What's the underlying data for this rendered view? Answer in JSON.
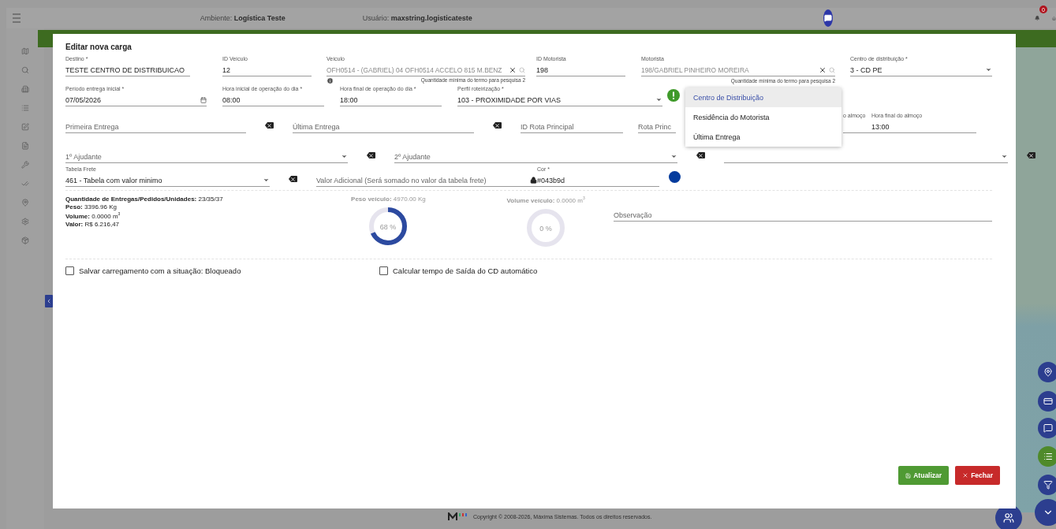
{
  "header": {
    "ambiente_label": "Ambiente:",
    "ambiente_value": "Logística Teste",
    "usuario_label": "Usuário:",
    "usuario_value": "maxstring.logisticateste",
    "notification_count": "0"
  },
  "modal": {
    "title": "Editar nova carga",
    "sections": [
      {
        "fields": [
          {
            "kind": "text",
            "label": "Destino *",
            "value": "TESTE CENTRO DE DISTRIBUICAO"
          },
          {
            "kind": "text",
            "label": "ID Veículo",
            "value": "12"
          },
          {
            "kind": "search",
            "label": "Veículo",
            "value": "OFH0514 - (GABRIEL) 04 OFH0514 ACCELO 815 M.BENZ",
            "disabled": true,
            "helper": "Quantidade mínima do termo para pesquisa 2",
            "info": true
          },
          {
            "kind": "text",
            "label": "ID Motorista",
            "value": "198"
          },
          {
            "kind": "search",
            "label": "Motorista",
            "value": "198/GABRIEL PINHEIRO MOREIRA",
            "disabled": true,
            "helper": "Quantidade mínima do termo para pesquisa 2"
          },
          {
            "kind": "select",
            "label": "Centro de distribuição *",
            "value": "3 - CD PE"
          }
        ]
      },
      {
        "fields": [
          {
            "kind": "date",
            "label": "Período entrega inicial *",
            "value": "07/05/2026"
          },
          {
            "kind": "text",
            "label": "Hora inicial de operação do dia *",
            "value": "08:00"
          },
          {
            "kind": "text",
            "label": "Hora final de operação do dia *",
            "value": "18:00"
          },
          {
            "kind": "select",
            "label": "Perfil roteirização *",
            "value": "103 - PROXIMIDADE POR VIAS",
            "warning": true
          }
        ]
      },
      {
        "fields": [
          {
            "kind": "text",
            "placeholder": "Primeira Entrega",
            "clearable": true
          },
          {
            "kind": "text",
            "placeholder": "Última Entrega",
            "clearable": true
          },
          {
            "kind": "text",
            "placeholder": "ID Rota Principal"
          },
          {
            "kind": "text",
            "placeholder": "Rota Princ"
          },
          {
            "kind": "text",
            "label": "o almoço"
          },
          {
            "kind": "text",
            "label": "Hora final do almoço",
            "value": "13:00"
          }
        ]
      },
      {
        "fields": [
          {
            "kind": "select",
            "placeholder": "1º Ajudante",
            "clearable": true
          },
          {
            "kind": "select",
            "placeholder": "2º Ajudante",
            "clearable": true
          },
          {
            "kind": "select",
            "clearable": true
          }
        ]
      },
      {
        "fields": [
          {
            "kind": "select",
            "label": "Tabela Frete",
            "value": "461 - Tabela com valor minimo",
            "clearable": true
          },
          {
            "kind": "text",
            "placeholder": "Valor Adicional (Será somado no valor da tabela frete)",
            "locked": true
          },
          {
            "kind": "color",
            "label": "Cor *",
            "value": "#043b9d"
          }
        ]
      }
    ],
    "dropdown": {
      "options": [
        {
          "label": "Centro de Distribuição",
          "selected": true
        },
        {
          "label": "Residência do Motorista",
          "selected": false
        },
        {
          "label": "Última Entrega",
          "selected": false
        }
      ]
    },
    "stats": [
      {
        "label": "Quantidade de Entregas/Pedidos/Unidades:",
        "value": "23/35/37"
      },
      {
        "label": "Peso:",
        "value": "3396.96 Kg"
      },
      {
        "label": "Volume:",
        "value": "0.0000 m$^{3}$"
      },
      {
        "label": "Valor:",
        "value": "R$ 6.216,47"
      }
    ],
    "gauges": [
      {
        "label": "Peso veículo:",
        "value": "4970.00 Kg",
        "percent": "68 %",
        "level": 0.68
      },
      {
        "label": "Volume veículo:",
        "value": "0.0000 m$^{3}$",
        "percent": "0 %",
        "level": 0
      }
    ],
    "observacao": {
      "placeholder": "Observação"
    },
    "checkboxes": [
      {
        "label": "Salvar carregamento com a situação: Bloqueado",
        "checked": false
      },
      {
        "label": "Calcular tempo de Saída do CD automático",
        "checked": false
      }
    ],
    "buttons": [
      {
        "label": "Atualizar",
        "kind": "primary"
      },
      {
        "label": "Fechar",
        "kind": "danger"
      }
    ]
  },
  "footer": {
    "copyright": "Copyright © 2008-2026, Máxima Sistemas. Todos os direitos reservados."
  }
}
